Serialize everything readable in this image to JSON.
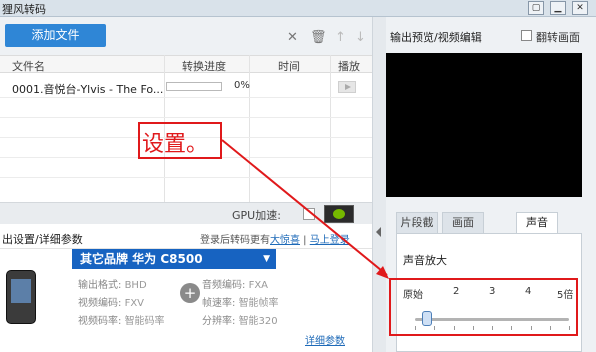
{
  "window": {
    "title": "狸风转码",
    "buttons": [
      "▢",
      "▁",
      "✕"
    ]
  },
  "toolbar": {
    "add_file_label": "添加文件",
    "icons": [
      "close-icon",
      "trash-icon",
      "arrow-up-icon",
      "arrow-down-icon"
    ]
  },
  "file_table": {
    "headers": {
      "filename": "文件名",
      "progress": "转换进度",
      "time": "时间",
      "play": "播放"
    },
    "rows": [
      {
        "filename": "0001.音悦台-Ylvis - The Fo...",
        "progress_percent": 0,
        "progress_label": "0%",
        "time": ""
      }
    ]
  },
  "gpu": {
    "label": "GPU加速:",
    "checked": false
  },
  "settings": {
    "title": "出设置/详细参数",
    "login_text": "登录后转码更有",
    "link_big_boost": "大惊喜",
    "link_login": "马上登录",
    "brand": "其它品牌  华为  C8500",
    "specs": {
      "format_label": "输出格式:",
      "format_value": "BHD",
      "audio_codec_label": "音频编码:",
      "audio_codec_value": "FXA",
      "video_codec_label": "视频编码:",
      "video_codec_value": "FXV",
      "frame_rate_label": "帧速率:",
      "frame_rate_value": "智能帧率",
      "video_bitrate_label": "视频码率:",
      "video_bitrate_value": "智能码率",
      "resolution_label": "分辨率:",
      "resolution_value": "智能320"
    },
    "detail_link": "详细参数"
  },
  "preview": {
    "title": "输出预览/视频编辑",
    "flip_label": "翻转画面",
    "flip_checked": false
  },
  "edit_tabs": {
    "items": [
      "片段截取",
      "画面",
      "声音"
    ],
    "active_index": 2
  },
  "volume": {
    "title": "声音放大",
    "scale_labels": [
      "原始",
      "2",
      "3",
      "4",
      "5倍"
    ],
    "value_level": 1.3
  },
  "annotation": {
    "text": "设置。",
    "color": "#e0191b"
  }
}
